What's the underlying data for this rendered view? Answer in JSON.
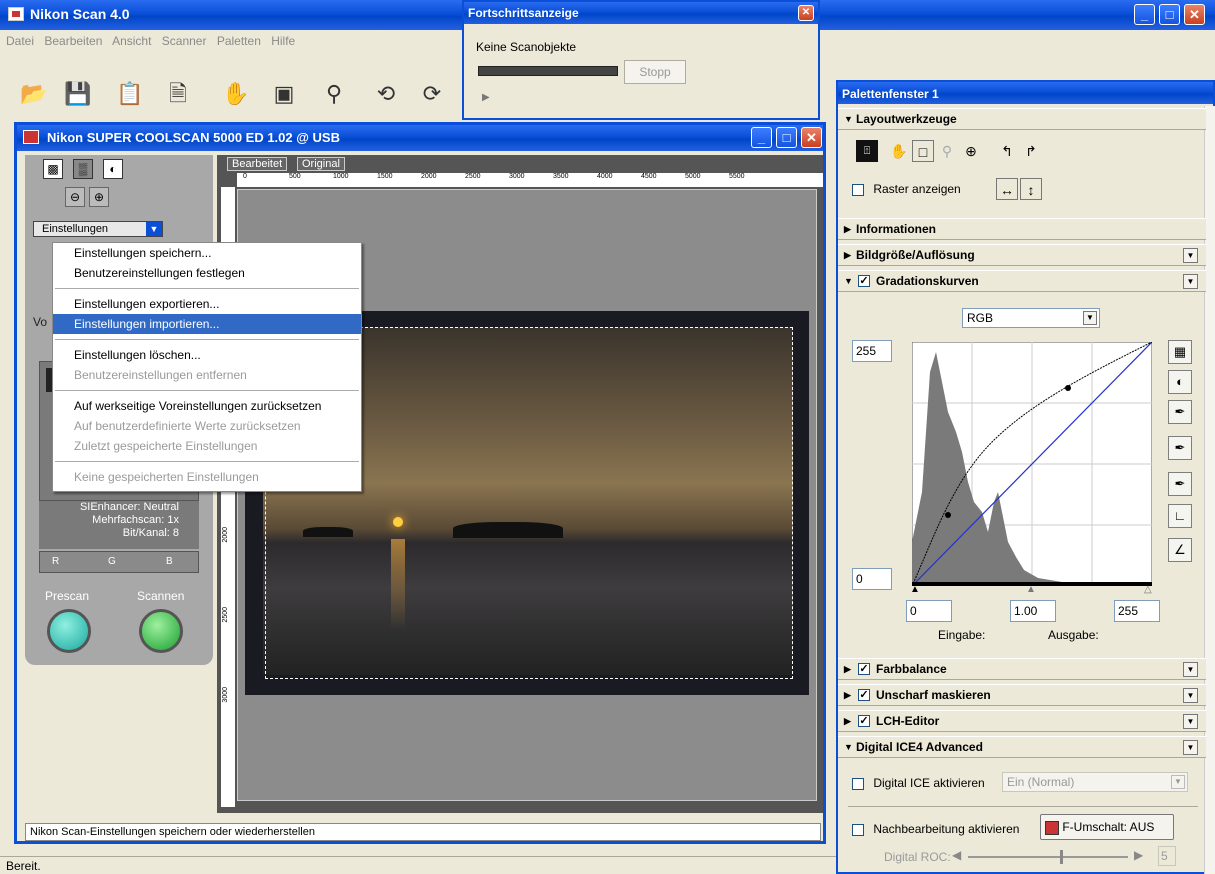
{
  "app": {
    "title": "Nikon Scan 4.0",
    "menu": [
      "Datei",
      "Bearbeiten",
      "Ansicht",
      "Scanner",
      "Paletten",
      "Hilfe"
    ],
    "toolbar_icons": [
      "open-icon",
      "save-icon",
      "copy-icon",
      "print-icon",
      "hand-icon",
      "crop-icon",
      "zoom-icon",
      "rotate-left-icon",
      "rotate-right-icon"
    ],
    "status": "Bereit."
  },
  "progress": {
    "title": "Fortschrittsanzeige",
    "message": "Keine Scanobjekte",
    "stop_label": "Stopp",
    "value": 0
  },
  "scan_window": {
    "title": "Nikon SUPER COOLSCAN 5000 ED 1.02 @ USB",
    "tabs": [
      "Bearbeitet",
      "Original"
    ],
    "ruler_labels": [
      "0",
      "500",
      "1000",
      "1500",
      "2000",
      "2500",
      "3000",
      "3500",
      "4000",
      "4500",
      "5000",
      "5500"
    ],
    "vruler_labels": [
      "2000",
      "2500",
      "3000"
    ],
    "settings_select": "Einstellungen",
    "left_prefix": "Vo",
    "info": {
      "enhancer": "SIEnhancer: Neutral",
      "multiscan": "Mehrfachscan: 1x",
      "bits": "Bit/Kanal: 8"
    },
    "rgb": [
      "R",
      "G",
      "B"
    ],
    "prescan_label": "Prescan",
    "scan_label": "Scannen",
    "status_text": "Nikon Scan-Einstellungen speichern oder wiederherstellen"
  },
  "context_menu": {
    "groups": [
      [
        {
          "label": "Einstellungen speichern...",
          "state": "normal"
        },
        {
          "label": "Benutzereinstellungen festlegen",
          "state": "normal"
        }
      ],
      [
        {
          "label": "Einstellungen exportieren...",
          "state": "normal"
        },
        {
          "label": "Einstellungen importieren...",
          "state": "selected"
        }
      ],
      [
        {
          "label": "Einstellungen löschen...",
          "state": "normal"
        },
        {
          "label": "Benutzereinstellungen entfernen",
          "state": "disabled"
        }
      ],
      [
        {
          "label": "Auf werkseitige Voreinstellungen zurücksetzen",
          "state": "normal"
        },
        {
          "label": "Auf benutzerdefinierte Werte zurücksetzen",
          "state": "disabled"
        },
        {
          "label": "Zuletzt gespeicherte Einstellungen",
          "state": "disabled"
        }
      ],
      [
        {
          "label": "Keine gespeicherten Einstellungen",
          "state": "disabled"
        }
      ]
    ]
  },
  "palette": {
    "title": "Palettenfenster 1",
    "sections": {
      "layout": "Layoutwerkzeuge",
      "info": "Informationen",
      "size": "Bildgröße/Auflösung",
      "curves": "Gradationskurven",
      "balance": "Farbbalance",
      "unsharp": "Unscharf maskieren",
      "lch": "LCH-Editor",
      "ice": "Digital ICE4 Advanced"
    },
    "raster_label": "Raster anzeigen",
    "curves": {
      "channel": "RGB",
      "out_max": "255",
      "out_min": "0",
      "in_black": "0",
      "gamma": "1.00",
      "in_white": "255",
      "input_label": "Eingabe:",
      "output_label": "Ausgabe:"
    },
    "ice": {
      "enable_label": "Digital ICE aktivieren",
      "mode": "Ein (Normal)",
      "post_label": "Nachbearbeitung aktivieren",
      "fswitch_label": "F-Umschalt: AUS",
      "roc_label": "Digital ROC:",
      "roc_value": "5"
    }
  },
  "colors": {
    "accent": "#316ac5",
    "titlebar": "#0a4fd8",
    "curve_line": "#2233cc"
  }
}
